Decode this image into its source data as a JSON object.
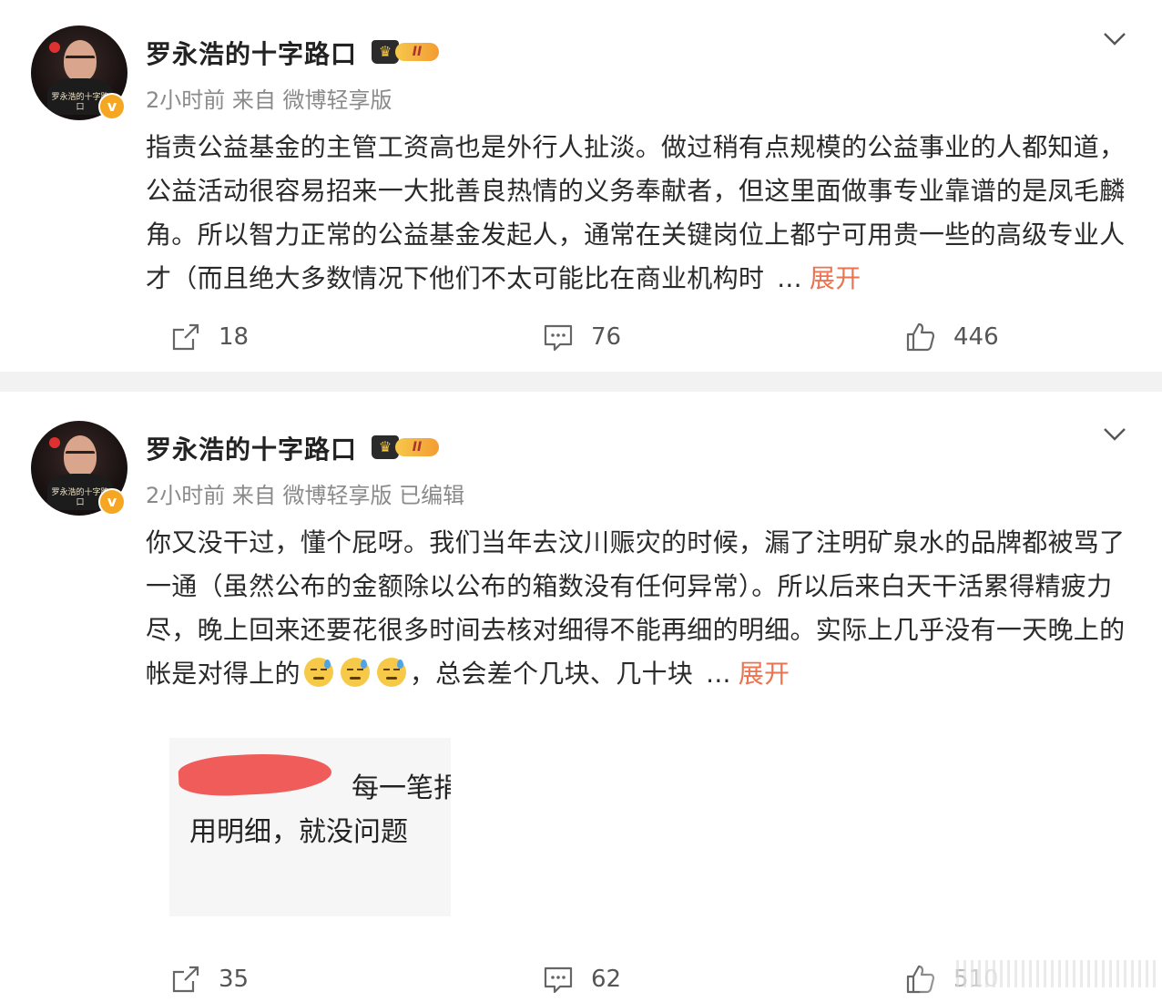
{
  "posts": [
    {
      "author": "罗永浩的十字路口",
      "vip_level": "II",
      "avatar_caption": "罗永浩的十字路口",
      "meta": "2小时前  来自 微博轻享版",
      "content": "指责公益基金的主管工资高也是外行人扯淡。做过稍有点规模的公益事业的人都知道，公益活动很容易招来一大批善良热情的义务奉献者，但这里面做事专业靠谱的是凤毛麟角。所以智力正常的公益基金发起人，通常在关键岗位上都宁可用贵一些的高级专业人才（而且绝大多数情况下他们不太可能比在商业机构时",
      "ellipsis": "...",
      "expand_label": "展开",
      "repost_count": "18",
      "comment_count": "76",
      "like_count": "446"
    },
    {
      "author": "罗永浩的十字路口",
      "vip_level": "II",
      "avatar_caption": "罗永浩的十字路口",
      "meta": "2小时前  来自 微博轻享版 已编辑",
      "content": "你又没干过，懂个屁呀。我们当年去汶川赈灾的时候，漏了注明矿泉水的品牌都被骂了一通（虽然公布的金额除以公布的箱数没有任何异常）。所以后来白天干活累得精疲力尽，晚上回来还要花很多时间去核对细得不能再细的明细。实际上几乎没有一天晚上的帐是对得上的",
      "content_tail": "，总会差个几块、几十块",
      "ellipsis": "...",
      "expand_label": "展开",
      "image_text_line1": "每一笔捐",
      "image_text_line2": "用明细，就没问题",
      "repost_count": "35",
      "comment_count": "62",
      "like_count": "510"
    }
  ],
  "colors": {
    "expand": "#eb7350",
    "verify": "#f5a623",
    "meta": "#8a8a8a",
    "separator": "#f2f2f2"
  },
  "icons": {
    "repost": "repost-icon",
    "comment": "comment-icon",
    "like": "thumbs-up-icon",
    "more": "chevron-down-icon",
    "verified": "verified-v-icon",
    "emoji": "sweat-emoji"
  }
}
